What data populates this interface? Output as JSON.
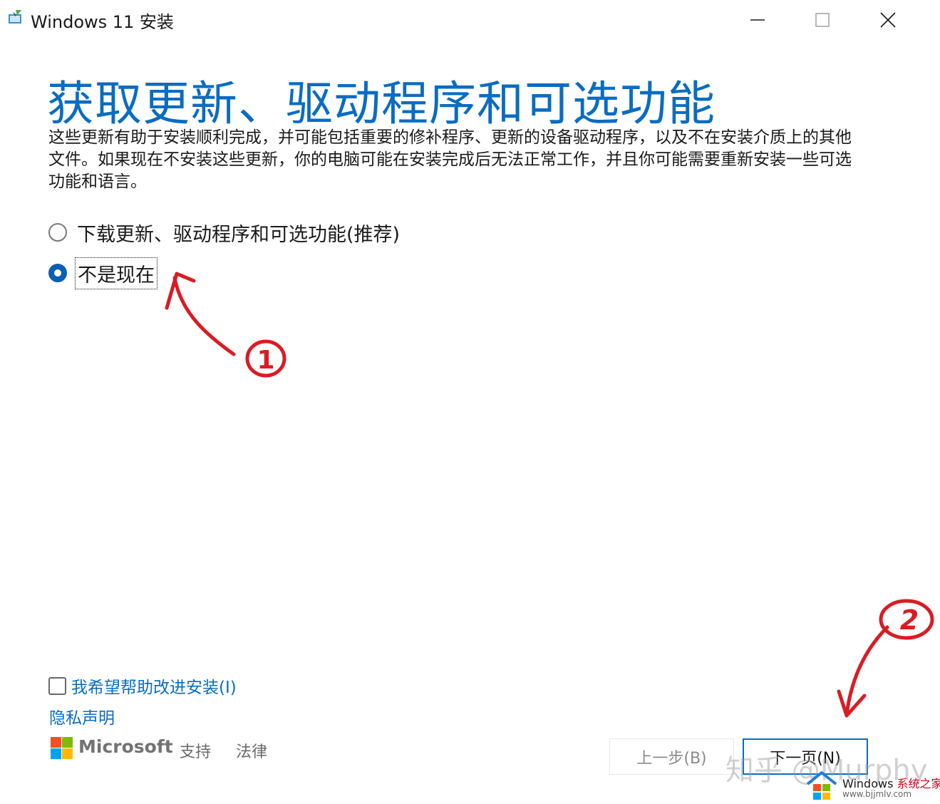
{
  "window": {
    "title": "Windows 11 安装",
    "controls": {
      "minimize": "minimize",
      "maximize": "maximize",
      "close": "close"
    }
  },
  "page": {
    "title": "获取更新、驱动程序和可选功能",
    "description": "这些更新有助于安装顺利完成，并可能包括重要的修补程序、更新的设备驱动程序，以及不在安装介质上的其他文件。如果现在不安装这些更新，你的电脑可能在安装完成后无法正常工作，并且你可能需要重新安装一些可选功能和语言。"
  },
  "options": [
    {
      "label": "下载更新、驱动程序和可选功能(推荐)",
      "selected": false
    },
    {
      "label": "不是现在",
      "selected": true
    }
  ],
  "annotations": {
    "step1": "1",
    "step2": "2"
  },
  "footer": {
    "improve_label": "我希望帮助改进安装(I)",
    "improve_checked": false,
    "privacy": "隐私声明",
    "brand": "Microsoft",
    "support": "支持",
    "legal": "法律"
  },
  "buttons": {
    "back": "上一步(B)",
    "next": "下一页(N)"
  },
  "watermark": {
    "zhihu": "知乎 @Murphy",
    "site_name": "Windows",
    "site_suffix": "系统之家",
    "site_url": "www.bjjmlv.com"
  },
  "colors": {
    "accent": "#0a6cc2",
    "annotation": "#d91c24",
    "ms_red": "#f25022",
    "ms_green": "#7fba00",
    "ms_blue": "#00a4ef",
    "ms_yellow": "#ffb900"
  }
}
